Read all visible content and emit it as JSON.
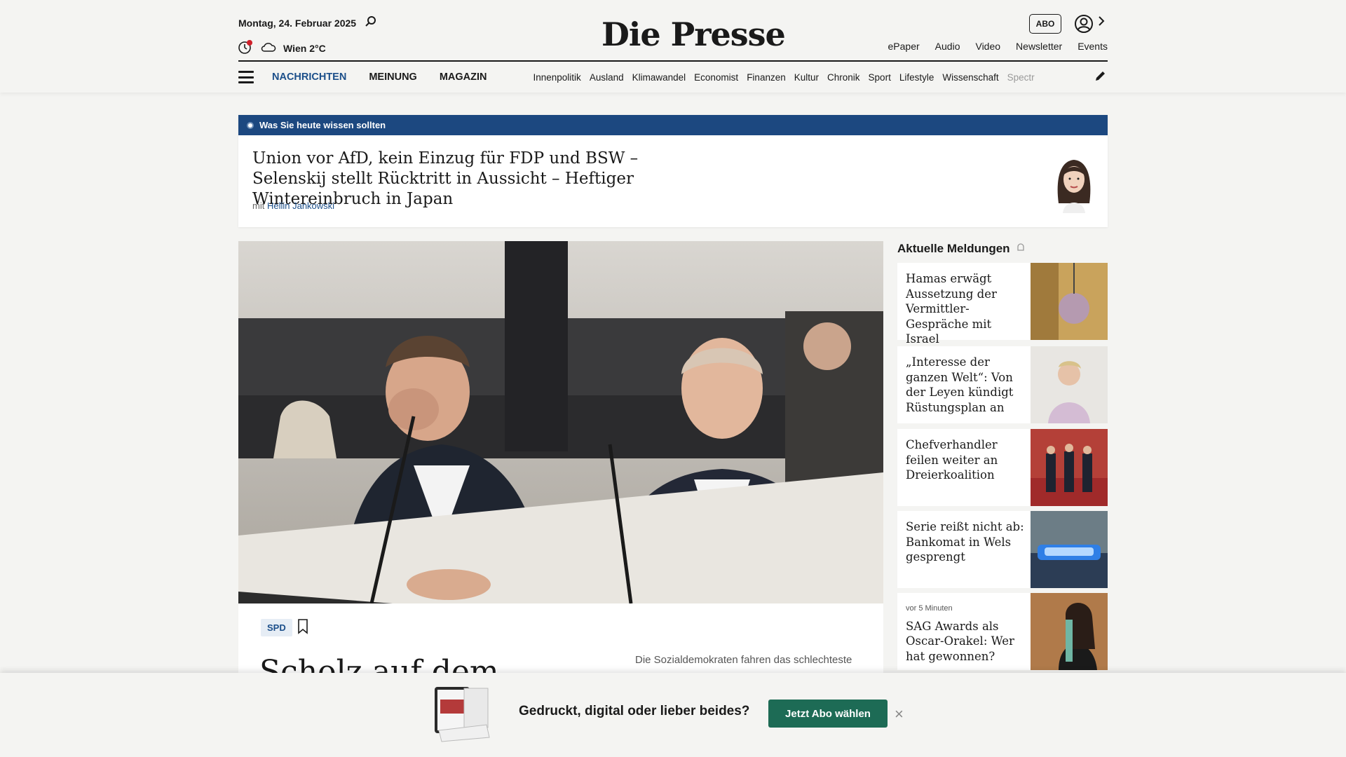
{
  "header": {
    "date": "Montag, 24. Februar 2025",
    "weather": "Wien 2°C",
    "logo": "Die Presse",
    "abo_label": "ABO",
    "util_links": [
      "ePaper",
      "Audio",
      "Video",
      "Newsletter",
      "Events"
    ]
  },
  "nav": {
    "main": [
      "NACHRICHTEN",
      "MEINUNG",
      "MAGAZIN"
    ],
    "sub": [
      "Innenpolitik",
      "Ausland",
      "Klimawandel",
      "Economist",
      "Finanzen",
      "Kultur",
      "Chronik",
      "Sport",
      "Lifestyle",
      "Wissenschaft",
      "Spectr"
    ]
  },
  "briefing": {
    "bar_label": "Was Sie heute wissen sollten",
    "title": "Union vor AfD, kein Einzug für FDP und BSW – Selenskij stellt Rücktritt in Aussicht – Heftiger Wintereinbruch in Japan",
    "author_prefix": "mit",
    "author": "Hellin Jankowski"
  },
  "lead_story": {
    "tag": "SPD",
    "headline": "Scholz auf dem",
    "teaser": "Die Sozialdemokraten fahren das schlechteste"
  },
  "sidebar": {
    "title": "Aktuelle Meldungen",
    "items": [
      {
        "meta": "",
        "title": "Hamas erwägt Aussetzung der Vermittler-Gespräche mit Israel"
      },
      {
        "meta": "",
        "title": "„Interesse der ganzen Welt“: Von der Leyen kündigt Rüstungsplan an"
      },
      {
        "meta": "",
        "title": "Chefverhandler feilen weiter an Dreierkoalition"
      },
      {
        "meta": "",
        "title": "Serie reißt nicht ab: Bankomat in Wels gesprengt"
      },
      {
        "meta": "vor 5 Minuten",
        "title": "SAG Awards als Oscar-Orakel: Wer hat gewonnen?"
      }
    ]
  },
  "promo": {
    "text": "Gedruckt, digital oder lieber beides?",
    "button": "Jetzt Abo wählen",
    "close": "×"
  },
  "colors": {
    "brand_blue": "#1c4880",
    "nav_active": "#1c4f8a",
    "cta_green": "#1d6b55"
  }
}
